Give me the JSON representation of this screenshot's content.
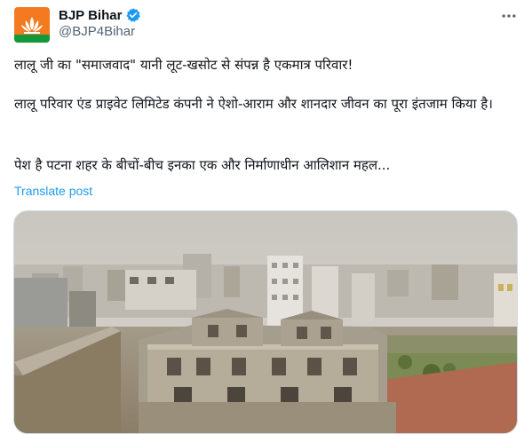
{
  "author": {
    "display_name": "BJP Bihar",
    "handle": "@BJP4Bihar",
    "verified": true,
    "avatar_icon": "bjp-lotus-logo-icon",
    "verified_icon": "verified-badge-icon",
    "verified_color": "#1d9bf0"
  },
  "tweet": {
    "para1": "लालू जी का \"समाजवाद\" यानी लूट-खसोट से संपन्न है एकमात्र परिवार!",
    "para2": "लालू परिवार एंड प्राइवेट लिमिटेड कंपनी ने ऐशो-आराम और शानदार जीवन का पूरा इंतजाम किया है।",
    "para3": "पेश है पटना शहर के बीचों-बीच इनका एक और निर्माणाधीन आलिशान महल...",
    "translate_label": "Translate post"
  },
  "toolbar": {
    "more_icon": "more-options-icon"
  },
  "colors": {
    "text": "#0f1419",
    "secondary": "#536471",
    "link": "#1d9bf0",
    "brand_orange": "#f47a20",
    "brand_green": "#129a3a"
  }
}
